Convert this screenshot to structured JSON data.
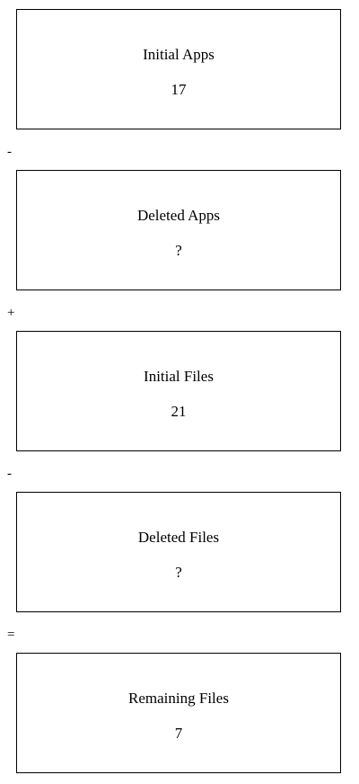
{
  "boxes": [
    {
      "label": "Initial Apps",
      "value": "17"
    },
    {
      "label": "Deleted Apps",
      "value": "?"
    },
    {
      "label": "Initial Files",
      "value": "21"
    },
    {
      "label": "Deleted Files",
      "value": "?"
    },
    {
      "label": "Remaining Files",
      "value": "7"
    }
  ],
  "operators": [
    "-",
    "+",
    "-",
    "="
  ]
}
